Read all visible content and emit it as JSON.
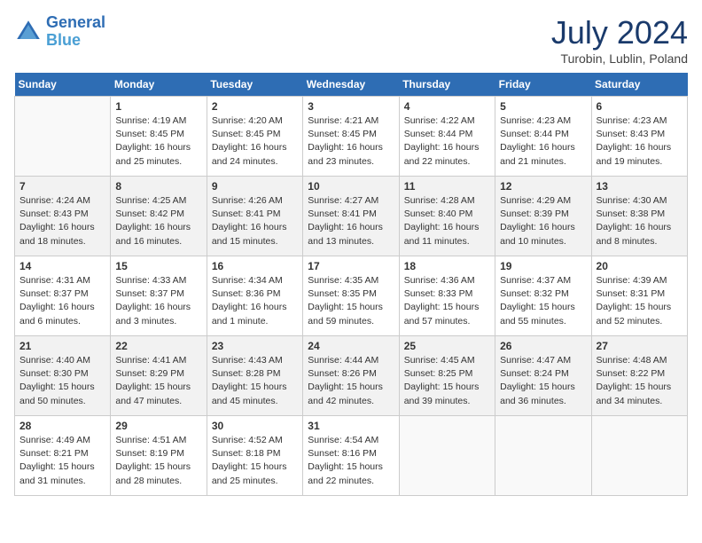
{
  "header": {
    "logo_line1": "General",
    "logo_line2": "Blue",
    "month_year": "July 2024",
    "location": "Turobin, Lublin, Poland"
  },
  "days_of_week": [
    "Sunday",
    "Monday",
    "Tuesday",
    "Wednesday",
    "Thursday",
    "Friday",
    "Saturday"
  ],
  "weeks": [
    [
      {
        "day": "",
        "empty": true
      },
      {
        "day": "1",
        "sunrise": "Sunrise: 4:19 AM",
        "sunset": "Sunset: 8:45 PM",
        "daylight": "Daylight: 16 hours and 25 minutes."
      },
      {
        "day": "2",
        "sunrise": "Sunrise: 4:20 AM",
        "sunset": "Sunset: 8:45 PM",
        "daylight": "Daylight: 16 hours and 24 minutes."
      },
      {
        "day": "3",
        "sunrise": "Sunrise: 4:21 AM",
        "sunset": "Sunset: 8:45 PM",
        "daylight": "Daylight: 16 hours and 23 minutes."
      },
      {
        "day": "4",
        "sunrise": "Sunrise: 4:22 AM",
        "sunset": "Sunset: 8:44 PM",
        "daylight": "Daylight: 16 hours and 22 minutes."
      },
      {
        "day": "5",
        "sunrise": "Sunrise: 4:23 AM",
        "sunset": "Sunset: 8:44 PM",
        "daylight": "Daylight: 16 hours and 21 minutes."
      },
      {
        "day": "6",
        "sunrise": "Sunrise: 4:23 AM",
        "sunset": "Sunset: 8:43 PM",
        "daylight": "Daylight: 16 hours and 19 minutes."
      }
    ],
    [
      {
        "day": "7",
        "sunrise": "Sunrise: 4:24 AM",
        "sunset": "Sunset: 8:43 PM",
        "daylight": "Daylight: 16 hours and 18 minutes."
      },
      {
        "day": "8",
        "sunrise": "Sunrise: 4:25 AM",
        "sunset": "Sunset: 8:42 PM",
        "daylight": "Daylight: 16 hours and 16 minutes."
      },
      {
        "day": "9",
        "sunrise": "Sunrise: 4:26 AM",
        "sunset": "Sunset: 8:41 PM",
        "daylight": "Daylight: 16 hours and 15 minutes."
      },
      {
        "day": "10",
        "sunrise": "Sunrise: 4:27 AM",
        "sunset": "Sunset: 8:41 PM",
        "daylight": "Daylight: 16 hours and 13 minutes."
      },
      {
        "day": "11",
        "sunrise": "Sunrise: 4:28 AM",
        "sunset": "Sunset: 8:40 PM",
        "daylight": "Daylight: 16 hours and 11 minutes."
      },
      {
        "day": "12",
        "sunrise": "Sunrise: 4:29 AM",
        "sunset": "Sunset: 8:39 PM",
        "daylight": "Daylight: 16 hours and 10 minutes."
      },
      {
        "day": "13",
        "sunrise": "Sunrise: 4:30 AM",
        "sunset": "Sunset: 8:38 PM",
        "daylight": "Daylight: 16 hours and 8 minutes."
      }
    ],
    [
      {
        "day": "14",
        "sunrise": "Sunrise: 4:31 AM",
        "sunset": "Sunset: 8:37 PM",
        "daylight": "Daylight: 16 hours and 6 minutes."
      },
      {
        "day": "15",
        "sunrise": "Sunrise: 4:33 AM",
        "sunset": "Sunset: 8:37 PM",
        "daylight": "Daylight: 16 hours and 3 minutes."
      },
      {
        "day": "16",
        "sunrise": "Sunrise: 4:34 AM",
        "sunset": "Sunset: 8:36 PM",
        "daylight": "Daylight: 16 hours and 1 minute."
      },
      {
        "day": "17",
        "sunrise": "Sunrise: 4:35 AM",
        "sunset": "Sunset: 8:35 PM",
        "daylight": "Daylight: 15 hours and 59 minutes."
      },
      {
        "day": "18",
        "sunrise": "Sunrise: 4:36 AM",
        "sunset": "Sunset: 8:33 PM",
        "daylight": "Daylight: 15 hours and 57 minutes."
      },
      {
        "day": "19",
        "sunrise": "Sunrise: 4:37 AM",
        "sunset": "Sunset: 8:32 PM",
        "daylight": "Daylight: 15 hours and 55 minutes."
      },
      {
        "day": "20",
        "sunrise": "Sunrise: 4:39 AM",
        "sunset": "Sunset: 8:31 PM",
        "daylight": "Daylight: 15 hours and 52 minutes."
      }
    ],
    [
      {
        "day": "21",
        "sunrise": "Sunrise: 4:40 AM",
        "sunset": "Sunset: 8:30 PM",
        "daylight": "Daylight: 15 hours and 50 minutes."
      },
      {
        "day": "22",
        "sunrise": "Sunrise: 4:41 AM",
        "sunset": "Sunset: 8:29 PM",
        "daylight": "Daylight: 15 hours and 47 minutes."
      },
      {
        "day": "23",
        "sunrise": "Sunrise: 4:43 AM",
        "sunset": "Sunset: 8:28 PM",
        "daylight": "Daylight: 15 hours and 45 minutes."
      },
      {
        "day": "24",
        "sunrise": "Sunrise: 4:44 AM",
        "sunset": "Sunset: 8:26 PM",
        "daylight": "Daylight: 15 hours and 42 minutes."
      },
      {
        "day": "25",
        "sunrise": "Sunrise: 4:45 AM",
        "sunset": "Sunset: 8:25 PM",
        "daylight": "Daylight: 15 hours and 39 minutes."
      },
      {
        "day": "26",
        "sunrise": "Sunrise: 4:47 AM",
        "sunset": "Sunset: 8:24 PM",
        "daylight": "Daylight: 15 hours and 36 minutes."
      },
      {
        "day": "27",
        "sunrise": "Sunrise: 4:48 AM",
        "sunset": "Sunset: 8:22 PM",
        "daylight": "Daylight: 15 hours and 34 minutes."
      }
    ],
    [
      {
        "day": "28",
        "sunrise": "Sunrise: 4:49 AM",
        "sunset": "Sunset: 8:21 PM",
        "daylight": "Daylight: 15 hours and 31 minutes."
      },
      {
        "day": "29",
        "sunrise": "Sunrise: 4:51 AM",
        "sunset": "Sunset: 8:19 PM",
        "daylight": "Daylight: 15 hours and 28 minutes."
      },
      {
        "day": "30",
        "sunrise": "Sunrise: 4:52 AM",
        "sunset": "Sunset: 8:18 PM",
        "daylight": "Daylight: 15 hours and 25 minutes."
      },
      {
        "day": "31",
        "sunrise": "Sunrise: 4:54 AM",
        "sunset": "Sunset: 8:16 PM",
        "daylight": "Daylight: 15 hours and 22 minutes."
      },
      {
        "day": "",
        "empty": true
      },
      {
        "day": "",
        "empty": true
      },
      {
        "day": "",
        "empty": true
      }
    ]
  ]
}
